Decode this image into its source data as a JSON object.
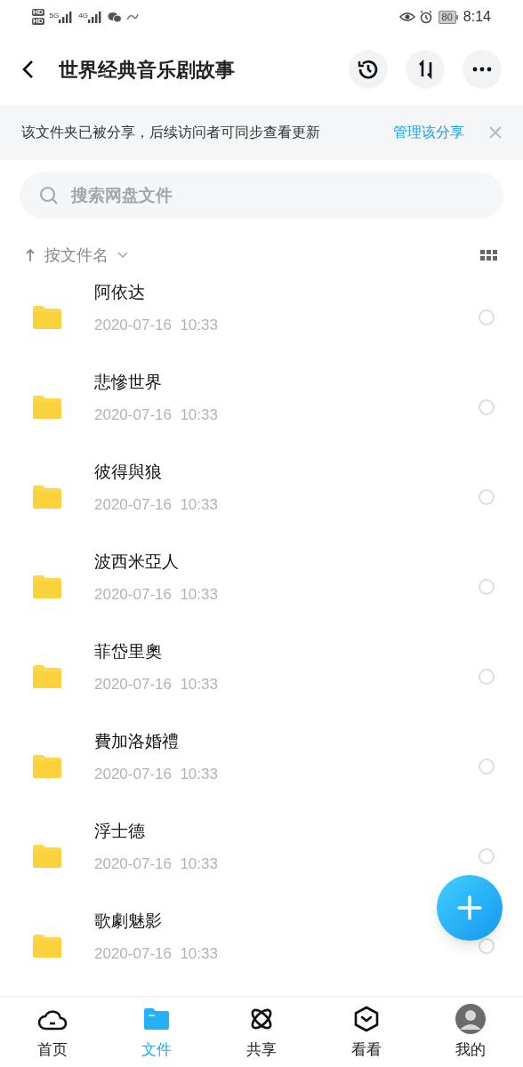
{
  "status_bar": {
    "sim_labels": [
      "HD",
      "HD"
    ],
    "signals": [
      "5G",
      "4G"
    ],
    "battery": "80",
    "time": "8:14"
  },
  "header": {
    "title": "世界经典音乐剧故事"
  },
  "share_notice": {
    "text": "该文件夹已被分享，后续访问者可同步查看更新",
    "action": "管理该分享"
  },
  "search": {
    "placeholder": "搜索网盘文件"
  },
  "sort": {
    "label": "按文件名"
  },
  "files": [
    {
      "name": "阿依达",
      "date": "2020-07-16  10:33",
      "selected": false
    },
    {
      "name": "悲慘世界",
      "date": "2020-07-16  10:33",
      "selected": false
    },
    {
      "name": "彼得與狼",
      "date": "2020-07-16  10:33",
      "selected": false
    },
    {
      "name": "波西米亞人",
      "date": "2020-07-16  10:33",
      "selected": false
    },
    {
      "name": "菲岱里奧",
      "date": "2020-07-16  10:33",
      "selected": false
    },
    {
      "name": "費加洛婚禮",
      "date": "2020-07-16  10:33",
      "selected": false
    },
    {
      "name": "浮士德",
      "date": "2020-07-16  10:33",
      "selected": false
    },
    {
      "name": "歌劇魅影",
      "date": "2020-07-16  10:33",
      "selected": false
    }
  ],
  "tabs": [
    {
      "label": "首页",
      "kind": "home",
      "selected": false
    },
    {
      "label": "文件",
      "kind": "files",
      "selected": true
    },
    {
      "label": "共享",
      "kind": "share",
      "selected": false
    },
    {
      "label": "看看",
      "kind": "watch",
      "selected": false
    },
    {
      "label": "我的",
      "kind": "me",
      "selected": false
    }
  ]
}
